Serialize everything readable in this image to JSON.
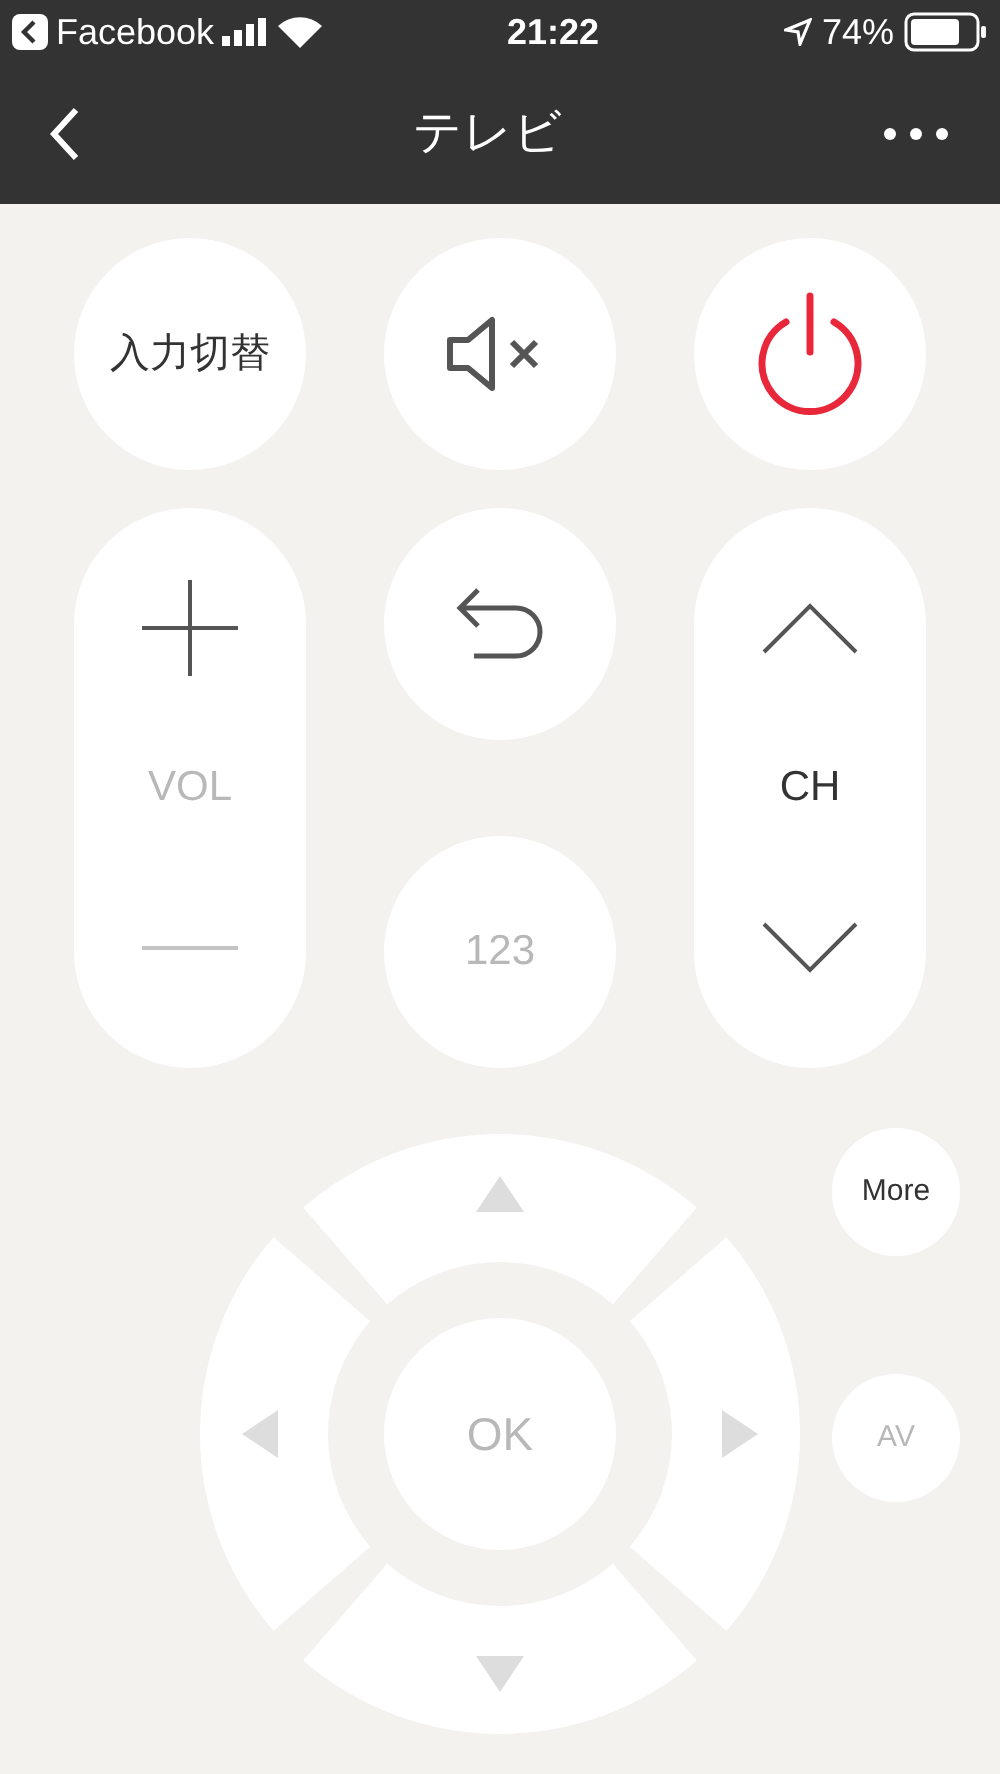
{
  "status_bar": {
    "back_app": "Facebook",
    "time": "21:22",
    "battery": "74%"
  },
  "header": {
    "title": "テレビ"
  },
  "top_buttons": [
    {
      "kind": "text",
      "label": "入力切替",
      "disabled": false
    },
    {
      "kind": "mute",
      "disabled": false
    },
    {
      "kind": "power",
      "disabled": false
    }
  ],
  "volume": {
    "label": "VOL",
    "disabled": true,
    "up_disabled": false,
    "down_disabled": true
  },
  "return_button": {
    "disabled": false
  },
  "number_button": {
    "label": "123",
    "disabled": true
  },
  "channel": {
    "label": "CH",
    "disabled": false,
    "up_disabled": false,
    "down_disabled": false
  },
  "dpad": {
    "ok": "OK",
    "ok_disabled": true,
    "directions": [
      {
        "kind": "up",
        "disabled": true
      },
      {
        "kind": "right",
        "disabled": true
      },
      {
        "kind": "down",
        "disabled": true
      },
      {
        "kind": "left",
        "disabled": true
      }
    ]
  },
  "side_buttons": [
    {
      "label": "More",
      "disabled": false
    },
    {
      "label": "AV",
      "disabled": true
    }
  ]
}
